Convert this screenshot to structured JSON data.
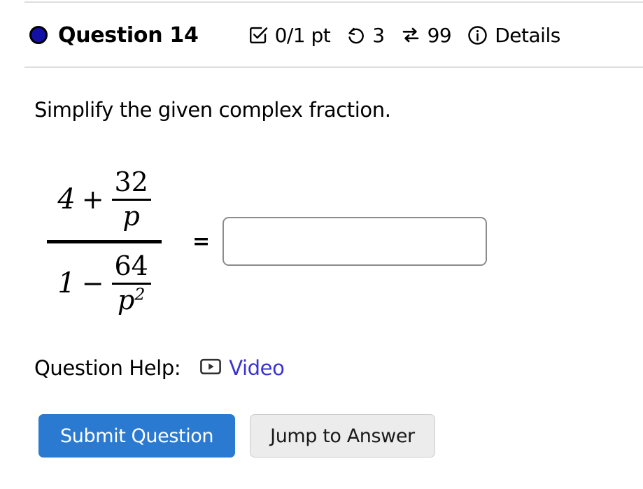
{
  "header": {
    "status_dot": {
      "icon": "filled-circle-icon",
      "color": "#1310a6"
    },
    "title": "Question 14",
    "score": {
      "icon": "checkbox-checked-icon",
      "label": "0/1 pt"
    },
    "attempts": {
      "icon": "undo-rotate-icon",
      "label": "3"
    },
    "versions": {
      "icon": "shuffle-swap-icon",
      "label": "99"
    },
    "details": {
      "icon": "info-circle-icon",
      "label": "Details"
    }
  },
  "prompt": "Simplify the given complex fraction.",
  "math": {
    "numerator": {
      "leading": "4",
      "operator": "+",
      "fraction": {
        "num": "32",
        "den": "p",
        "den_exponent": ""
      }
    },
    "denominator": {
      "leading": "1",
      "operator": "−",
      "fraction": {
        "num": "64",
        "den": "p",
        "den_exponent": "2"
      }
    },
    "equals": "=",
    "answer": {
      "value": "",
      "placeholder": ""
    }
  },
  "help": {
    "label": "Question Help:",
    "video": {
      "icon": "video-play-icon",
      "label": "Video",
      "color": "#3a33cf"
    }
  },
  "buttons": {
    "submit": {
      "label": "Submit Question",
      "color": "#2a7ad1"
    },
    "jump": {
      "label": "Jump to Answer",
      "color": "#ececec"
    }
  }
}
